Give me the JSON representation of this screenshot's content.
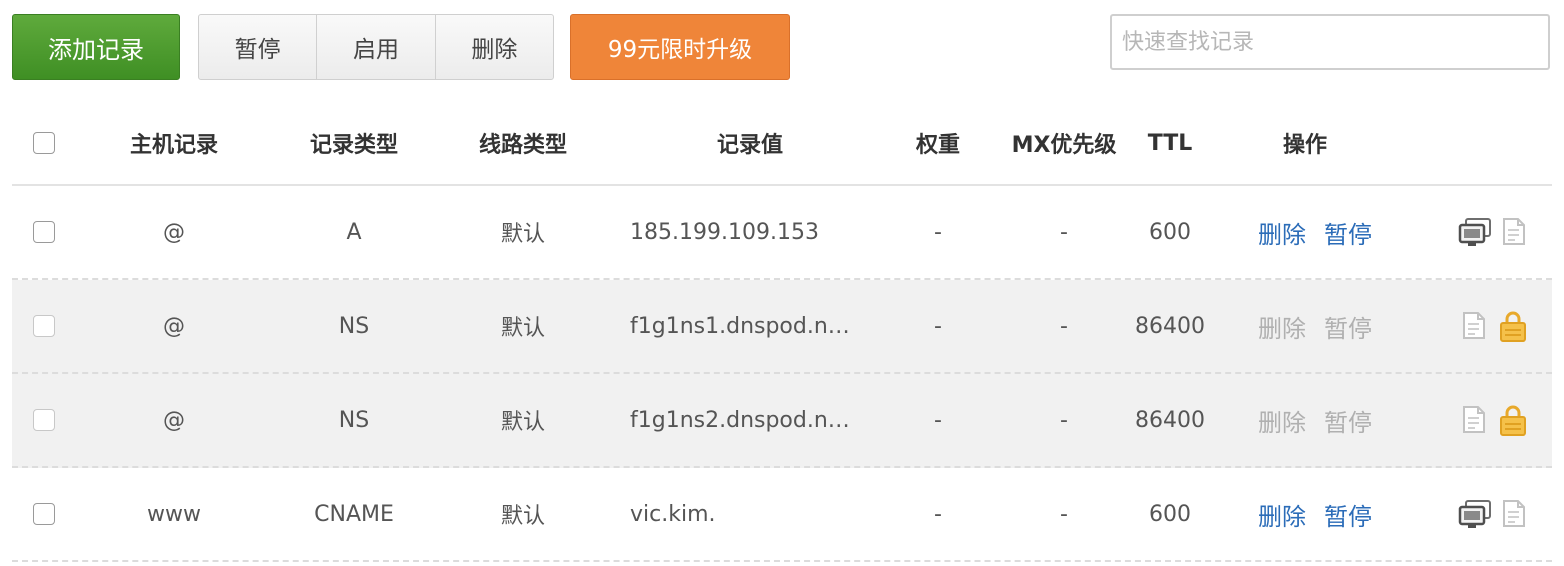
{
  "toolbar": {
    "add_label": "添加记录",
    "pause_label": "暂停",
    "enable_label": "启用",
    "delete_label": "删除",
    "upgrade_label": "99元限时升级",
    "search_placeholder": "快速查找记录"
  },
  "table": {
    "headers": {
      "host": "主机记录",
      "type": "记录类型",
      "line": "线路类型",
      "value": "记录值",
      "weight": "权重",
      "mx": "MX优先级",
      "ttl": "TTL",
      "ops": "操作"
    },
    "rows": [
      {
        "host": "@",
        "type": "A",
        "line": "默认",
        "value": "185.199.109.153",
        "weight": "-",
        "mx": "-",
        "ttl": "600",
        "op_delete": "删除",
        "op_pause": "暂停",
        "ops_enabled": true,
        "icons": [
          "monitor-icon",
          "note-icon"
        ]
      },
      {
        "host": "@",
        "type": "NS",
        "line": "默认",
        "value": "f1g1ns1.dnspod.n…",
        "weight": "-",
        "mx": "-",
        "ttl": "86400",
        "op_delete": "删除",
        "op_pause": "暂停",
        "ops_enabled": false,
        "icons": [
          "note-icon",
          "lock-icon"
        ]
      },
      {
        "host": "@",
        "type": "NS",
        "line": "默认",
        "value": "f1g1ns2.dnspod.n…",
        "weight": "-",
        "mx": "-",
        "ttl": "86400",
        "op_delete": "删除",
        "op_pause": "暂停",
        "ops_enabled": false,
        "icons": [
          "note-icon",
          "lock-icon"
        ]
      },
      {
        "host": "www",
        "type": "CNAME",
        "line": "默认",
        "value": "vic.kim.",
        "weight": "-",
        "mx": "-",
        "ttl": "600",
        "op_delete": "删除",
        "op_pause": "暂停",
        "ops_enabled": true,
        "icons": [
          "monitor-icon",
          "note-icon"
        ]
      }
    ]
  },
  "colors": {
    "add_green": "#4a9a2e",
    "upgrade_orange": "#ef8539",
    "link_blue": "#2b6cb8",
    "disabled_gray": "#b0b0b0",
    "lock_yellow": "#f5b939"
  }
}
